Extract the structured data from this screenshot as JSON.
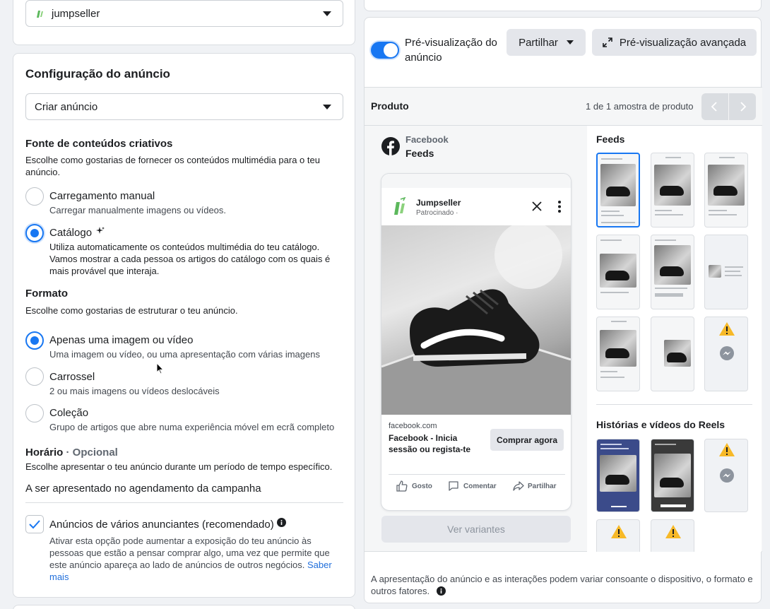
{
  "account": {
    "name": "jumpseller"
  },
  "ad_setup": {
    "title": "Configuração do anúncio",
    "mode_select": "Criar anúncio",
    "creative_source": {
      "title": "Fonte de conteúdos criativos",
      "desc": "Escolhe como gostarias de fornecer os conteúdos multimédia para o teu anúncio.",
      "options": [
        {
          "title": "Carregamento manual",
          "sub": "Carregar manualmente imagens ou vídeos.",
          "selected": false
        },
        {
          "title": "Catálogo",
          "sub": "Utiliza automaticamente os conteúdos multimédia do teu catálogo. Vamos mostrar a cada pessoa os artigos do catálogo com os quais é mais provável que interaja.",
          "selected": true
        }
      ]
    },
    "format": {
      "title": "Formato",
      "desc": "Escolhe como gostarias de estruturar o teu anúncio.",
      "options": [
        {
          "title": "Apenas uma imagem ou vídeo",
          "sub": "Uma imagem ou vídeo, ou uma apresentação com várias imagens",
          "selected": true
        },
        {
          "title": "Carrossel",
          "sub": "2 ou mais imagens ou vídeos deslocáveis",
          "selected": false
        },
        {
          "title": "Coleção",
          "sub": "Grupo de artigos que abre numa experiência móvel em ecrã completo",
          "selected": false
        }
      ]
    },
    "schedule": {
      "title": "Horário",
      "optional": "· Opcional",
      "desc": "Escolhe apresentar o teu anúncio durante um período de tempo específico.",
      "value": "A ser apresentado no agendamento da campanha"
    },
    "multi_advertiser": {
      "label": "Anúncios de vários anunciantes (recomendado)",
      "checked": true,
      "desc": "Ativar esta opção pode aumentar a exposição do teu anúncio às pessoas que estão a pensar comprar algo, uma vez que permite que este anúncio apareça ao lado de anúncios de outros negócios.",
      "link": "Saber mais"
    }
  },
  "preview": {
    "toggle_label": "Pré-visualização do anúncio",
    "toggle_on": true,
    "share_label": "Partilhar",
    "advanced_label": "Pré-visualização avançada",
    "product_label": "Produto",
    "sample_count": "1 de 1 amostra de produto",
    "platform": "Facebook",
    "placement": "Feeds",
    "post": {
      "page_name": "Jumpseller",
      "sponsored": "Patrocinado ·",
      "domain": "facebook.com",
      "headline": "Facebook - Inicia sessão ou regista-te",
      "cta": "Comprar agora",
      "like": "Gosto",
      "comment": "Comentar",
      "share": "Partilhar"
    },
    "variants_button": "Ver variantes",
    "feeds_title": "Feeds",
    "stories_title": "Histórias e vídeos do Reels",
    "footer_note": "A apresentação do anúncio e as interações podem variar consoante o dispositivo, o formato e outros fatores."
  },
  "colors": {
    "accent": "#1877f2",
    "warning": "#f7b928",
    "brand_green": "#5cb85c"
  },
  "icons": [
    "jumpseller-logo-icon",
    "caret-down-icon",
    "sparkle-icon",
    "info-icon",
    "check-icon",
    "expand-icon",
    "facebook-icon",
    "close-icon",
    "more-icon",
    "like-icon",
    "comment-icon",
    "share-icon",
    "chevron-left-icon",
    "chevron-right-icon",
    "warning-icon",
    "messenger-icon"
  ]
}
